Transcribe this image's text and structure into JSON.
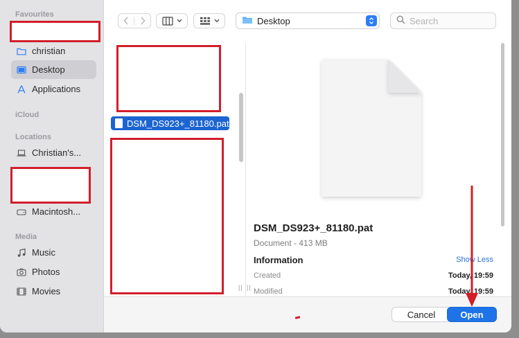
{
  "sidebar": {
    "favourites_title": "Favourites",
    "favourites": [
      {
        "label": "christian",
        "icon": "folder-icon"
      },
      {
        "label": "Desktop",
        "icon": "desktop-icon"
      },
      {
        "label": "Applications",
        "icon": "applications-icon"
      }
    ],
    "icloud_title": "iCloud",
    "locations_title": "Locations",
    "locations": [
      {
        "label": "Christian's...",
        "icon": "laptop-icon"
      },
      {
        "label": "Macintosh...",
        "icon": "drive-icon"
      }
    ],
    "media_title": "Media",
    "media": [
      {
        "label": "Music",
        "icon": "music-icon"
      },
      {
        "label": "Photos",
        "icon": "camera-icon"
      },
      {
        "label": "Movies",
        "icon": "film-icon"
      }
    ]
  },
  "toolbar": {
    "location": "Desktop",
    "search_placeholder": "Search"
  },
  "browser": {
    "selected_file": "DSM_DS923+_81180.pat"
  },
  "preview": {
    "file_name": "DSM_DS923+_81180.pat",
    "kind_size": "Document - 413 MB",
    "info_title": "Information",
    "show_less": "Show Less",
    "created_label": "Created",
    "created_value": "Today, 19:59",
    "modified_label": "Modified",
    "modified_value": "Today, 19:59"
  },
  "footer": {
    "cancel_label": "Cancel",
    "open_label": "Open"
  },
  "colors": {
    "accent": "#1e73e8",
    "annotation_red": "#d21e2a",
    "selection": "#1c64d1"
  }
}
